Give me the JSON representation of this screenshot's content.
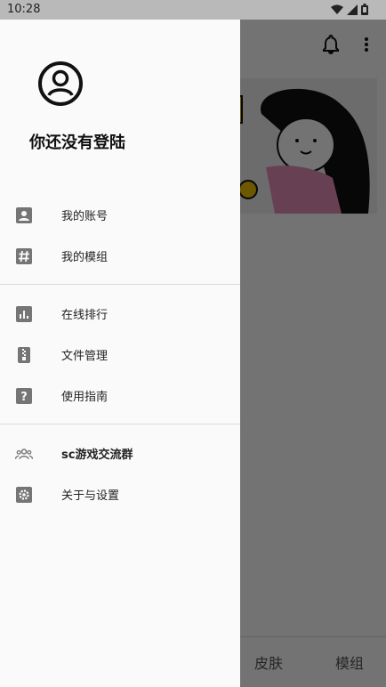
{
  "status_bar": {
    "time": "10:28"
  },
  "drawer": {
    "header": {
      "login_text": "你还没有登陆"
    },
    "menu": {
      "group1": [
        {
          "label": "我的账号",
          "icon": "account-box-icon"
        },
        {
          "label": "我的模组",
          "icon": "hash-icon"
        }
      ],
      "group2": [
        {
          "label": "在线排行",
          "icon": "ranking-chart-icon"
        },
        {
          "label": "文件管理",
          "icon": "file-archive-icon"
        },
        {
          "label": "使用指南",
          "icon": "help-icon"
        }
      ],
      "group3": [
        {
          "label": "sc游戏交流群",
          "icon": "group-icon"
        },
        {
          "label": "关于与设置",
          "icon": "settings-icon"
        }
      ]
    }
  },
  "background_app": {
    "bottom_nav": [
      "皮肤",
      "模组"
    ]
  },
  "colors": {
    "icon_gray": "#757575",
    "drawer_bg": "#fafafa",
    "scrim": "rgba(0,0,0,0.55)"
  }
}
